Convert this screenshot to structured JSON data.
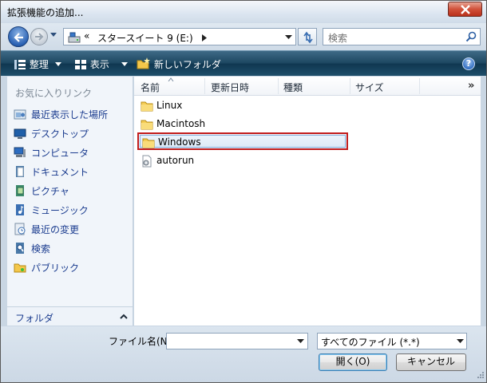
{
  "window": {
    "title": "拡張機能の追加..."
  },
  "address": {
    "chevron": "«",
    "path": "スタースイート 9 (E:)",
    "separator": "▸"
  },
  "search": {
    "placeholder": "検索"
  },
  "toolbar": {
    "organize_label": "整理",
    "views_label": "表示",
    "new_folder_label": "新しいフォルダ",
    "help_label": "?"
  },
  "navpane": {
    "header": "お気に入りリンク",
    "items": [
      {
        "label": "最近表示した場所",
        "icon": "recent-places-icon"
      },
      {
        "label": "デスクトップ",
        "icon": "desktop-icon"
      },
      {
        "label": "コンピュータ",
        "icon": "computer-icon"
      },
      {
        "label": "ドキュメント",
        "icon": "documents-icon"
      },
      {
        "label": "ピクチャ",
        "icon": "pictures-icon"
      },
      {
        "label": "ミュージック",
        "icon": "music-icon"
      },
      {
        "label": "最近の変更",
        "icon": "recently-changed-icon"
      },
      {
        "label": "検索",
        "icon": "searches-icon"
      },
      {
        "label": "パブリック",
        "icon": "public-folder-icon"
      }
    ],
    "folders_label": "フォルダ"
  },
  "filelist": {
    "columns": [
      "名前",
      "更新日時",
      "種類",
      "サイズ"
    ],
    "more_columns": "»",
    "files": [
      {
        "name": "Linux",
        "icon": "folder-icon"
      },
      {
        "name": "Macintosh",
        "icon": "folder-icon"
      },
      {
        "name": "Windows",
        "icon": "folder-icon",
        "selected": true
      },
      {
        "name": "autorun",
        "icon": "settings-file-icon"
      }
    ]
  },
  "bottom": {
    "filename_label": "ファイル名(N):",
    "filename_value": "",
    "filetype_value": "すべてのファイル (*.*)",
    "open_label": "開く(O)",
    "cancel_label": "キャンセル"
  },
  "colors": {
    "toolbar_bg": "#1c4660",
    "nav_link": "#1b3c8f",
    "selection_outline": "#c21d1d"
  }
}
